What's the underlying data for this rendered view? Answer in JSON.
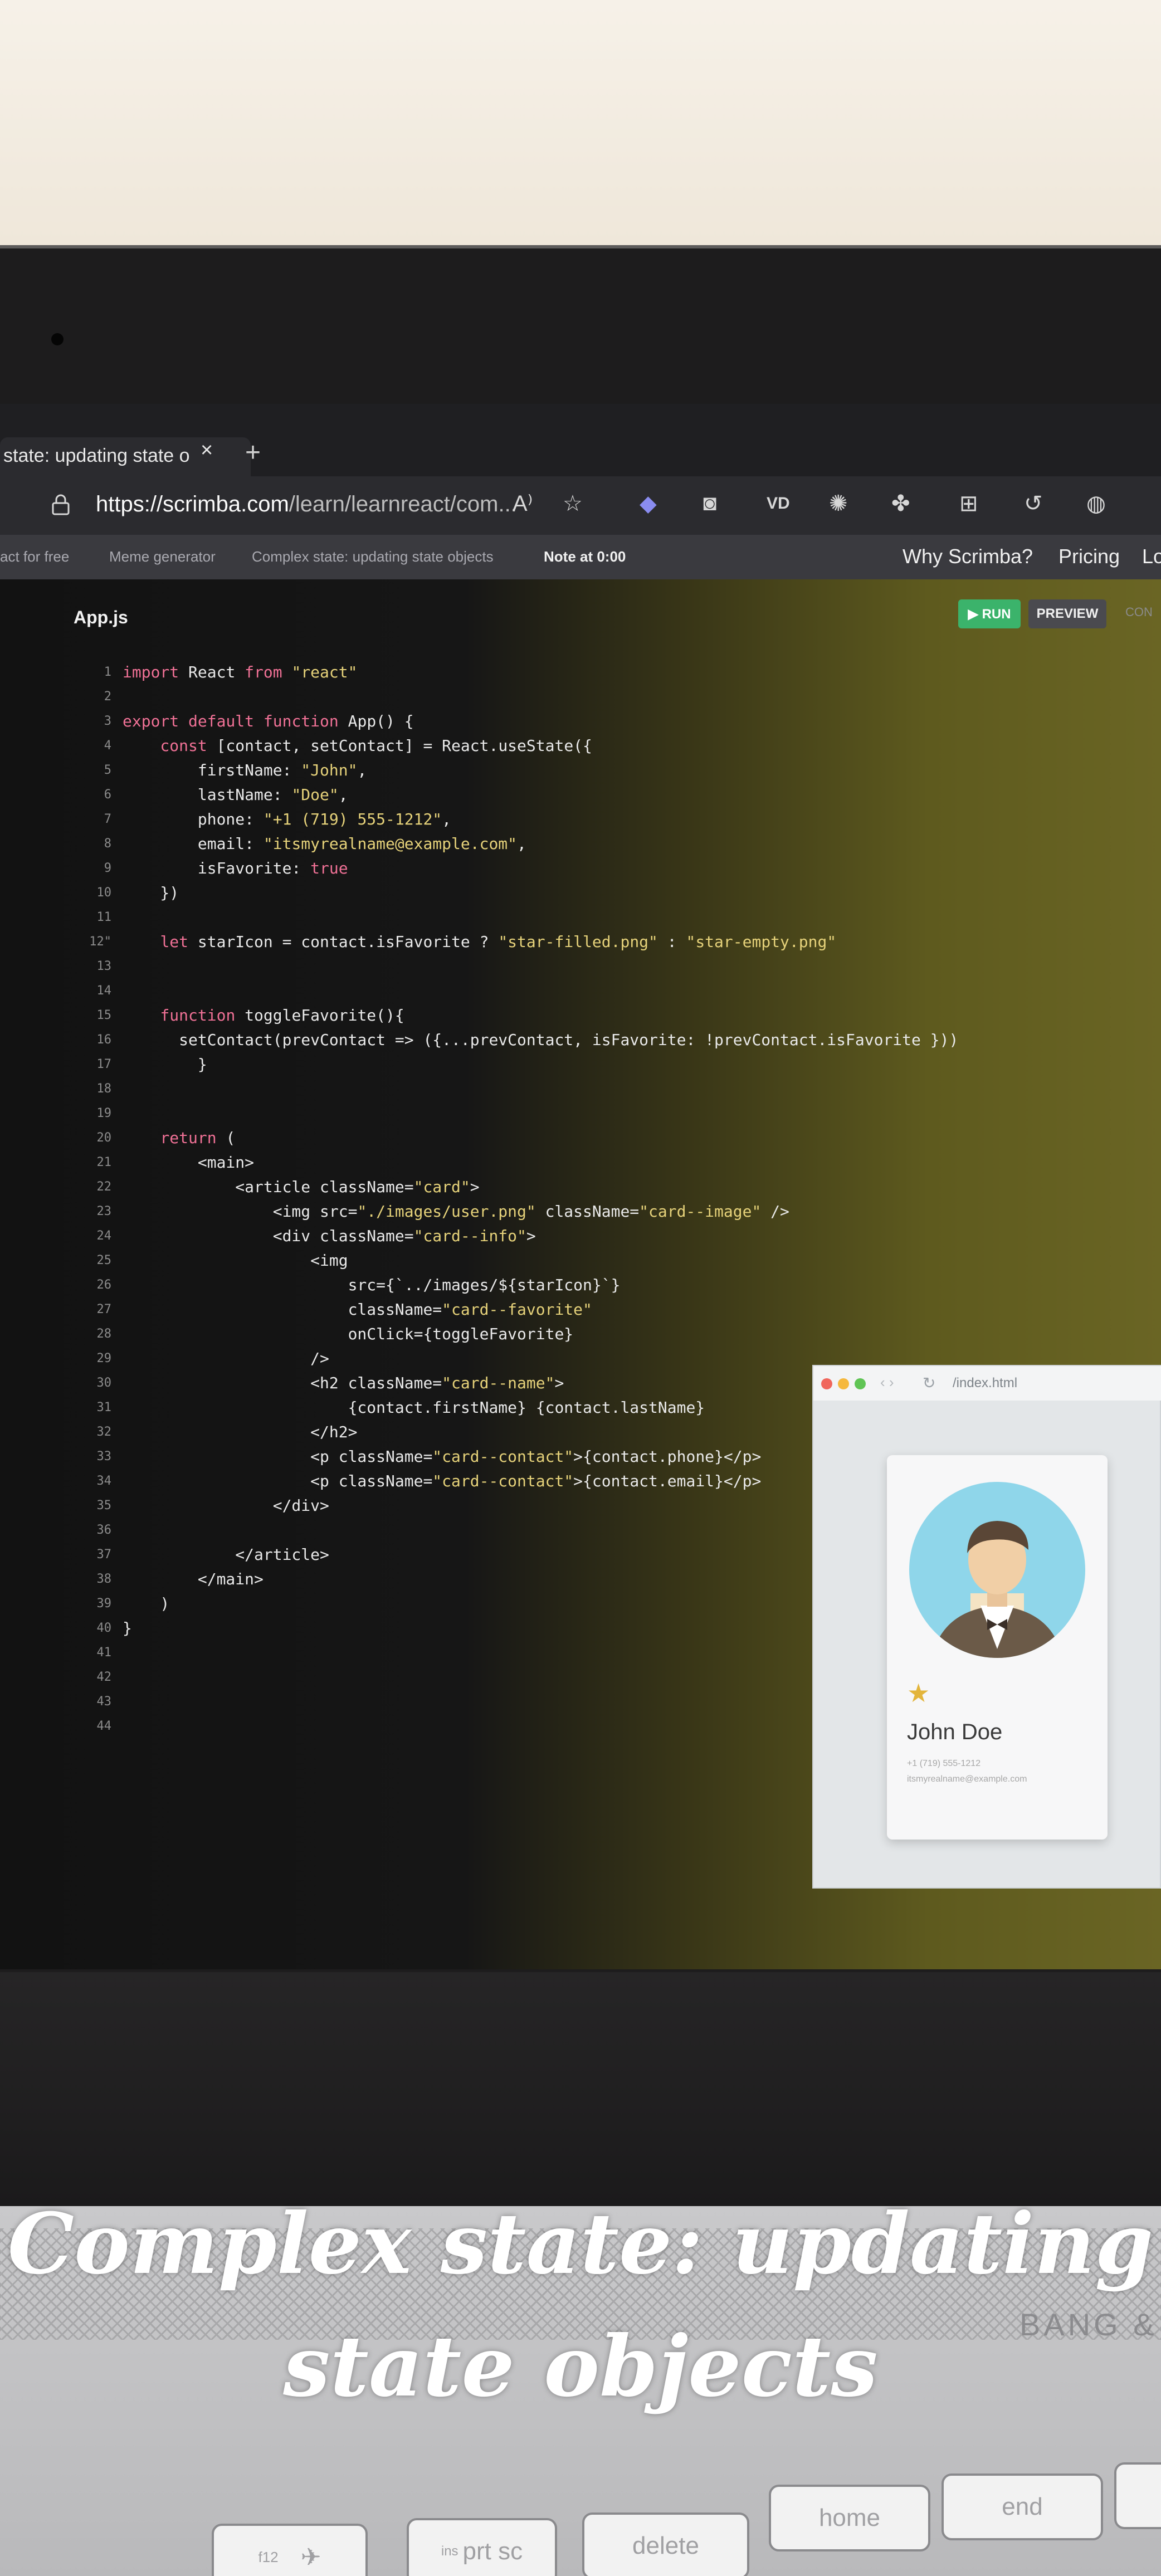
{
  "browser": {
    "tab_title": "state: updating state o",
    "tab_close": "×",
    "new_tab": "+",
    "url_domain": "https://scrimba.com",
    "url_path": "/learn/learnreact/com...",
    "toolbar_icons": [
      "read-aloud-icon",
      "favorites-icon",
      "extension-icon",
      "camera-icon",
      "vs-icon",
      "react-icon",
      "puzzle-icon",
      "collections-icon",
      "history-icon",
      "profile-icon"
    ]
  },
  "site_nav": {
    "items": [
      "act for free",
      "Meme generator",
      "Complex state: updating state objects",
      "Note at 0:00"
    ],
    "right": [
      "Why Scrimba?",
      "Pricing",
      "Lo"
    ]
  },
  "editor": {
    "file_tab": "App.js",
    "run_label": "▶ RUN",
    "preview_label": "PREVIEW",
    "console_label": "CON",
    "lines": [
      {
        "n": "1",
        "text": "import React from \"react\""
      },
      {
        "n": "2",
        "text": ""
      },
      {
        "n": "3",
        "text": "export default function App() {"
      },
      {
        "n": "4",
        "text": "    const [contact, setContact] = React.useState({"
      },
      {
        "n": "5",
        "text": "        firstName: \"John\","
      },
      {
        "n": "6",
        "text": "        lastName: \"Doe\","
      },
      {
        "n": "7",
        "text": "        phone: \"+1 (719) 555-1212\","
      },
      {
        "n": "8",
        "text": "        email: \"itsmyrealname@example.com\","
      },
      {
        "n": "9",
        "text": "        isFavorite: true"
      },
      {
        "n": "10",
        "text": "    })"
      },
      {
        "n": "11",
        "text": ""
      },
      {
        "n": "12\"",
        "text": "    let starIcon = contact.isFavorite ? \"star-filled.png\" : \"star-empty.png\""
      },
      {
        "n": "13",
        "text": ""
      },
      {
        "n": "14",
        "text": ""
      },
      {
        "n": "15",
        "text": "    function toggleFavorite(){"
      },
      {
        "n": "16",
        "text": "      setContact(prevContact => ({...prevContact, isFavorite: !prevContact.isFavorite }))"
      },
      {
        "n": "17",
        "text": "        }"
      },
      {
        "n": "18",
        "text": ""
      },
      {
        "n": "19",
        "text": ""
      },
      {
        "n": "20",
        "text": "    return ("
      },
      {
        "n": "21",
        "text": "        <main>"
      },
      {
        "n": "22",
        "text": "            <article className=\"card\">"
      },
      {
        "n": "23",
        "text": "                <img src=\"./images/user.png\" className=\"card--image\" />"
      },
      {
        "n": "24",
        "text": "                <div className=\"card--info\">"
      },
      {
        "n": "25",
        "text": "                    <img"
      },
      {
        "n": "26",
        "text": "                        src={`../images/${starIcon}`}"
      },
      {
        "n": "27",
        "text": "                        className=\"card--favorite\""
      },
      {
        "n": "28",
        "text": "                        onClick={toggleFavorite}"
      },
      {
        "n": "29",
        "text": "                    />"
      },
      {
        "n": "30",
        "text": "                    <h2 className=\"card--name\">"
      },
      {
        "n": "31",
        "text": "                        {contact.firstName} {contact.lastName}"
      },
      {
        "n": "32",
        "text": "                    </h2>"
      },
      {
        "n": "33",
        "text": "                    <p className=\"card--contact\">{contact.phone}</p>"
      },
      {
        "n": "34",
        "text": "                    <p className=\"card--contact\">{contact.email}</p>"
      },
      {
        "n": "35",
        "text": "                </div>"
      },
      {
        "n": "36",
        "text": ""
      },
      {
        "n": "37",
        "text": "            </article>"
      },
      {
        "n": "38",
        "text": "        </main>"
      },
      {
        "n": "39",
        "text": "    )"
      },
      {
        "n": "40",
        "text": "}"
      },
      {
        "n": "41",
        "text": ""
      },
      {
        "n": "42",
        "text": ""
      },
      {
        "n": "43",
        "text": ""
      },
      {
        "n": "44",
        "text": ""
      }
    ]
  },
  "preview": {
    "url": "/index.html",
    "name": "John Doe",
    "phone": "+1 (719) 555-1212",
    "email": "itsmyrealname@example.com"
  },
  "keyboard": {
    "brand": "BANG &",
    "keys": [
      "f12",
      "prt sc",
      "delete",
      "home",
      "end"
    ],
    "ins_label": "ins"
  },
  "caption": {
    "line1": "Complex state: updating",
    "line2": "state objects"
  },
  "colors": {
    "keyword": "#f07196",
    "string": "#e6d27a",
    "run": "#3bb36b",
    "avatar_bg": "#8fd6ea"
  }
}
